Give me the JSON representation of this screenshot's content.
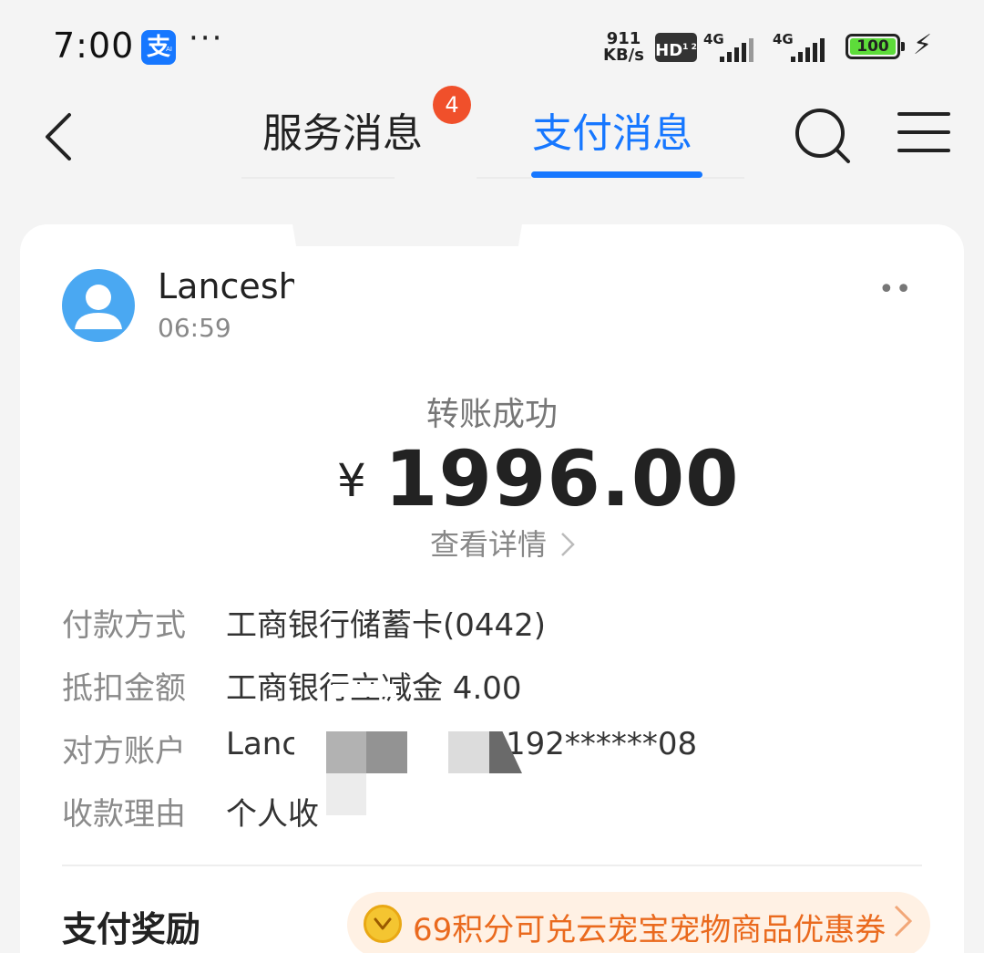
{
  "status_bar": {
    "time": "7:00",
    "app_glyph": "支",
    "app_sub": "AI",
    "more": "···",
    "net_speed_value": "911",
    "net_speed_unit": "KB/s",
    "hd": "HD",
    "hd_sub": "1 2",
    "signal_1": "4G",
    "signal_2": "4G",
    "battery": "100"
  },
  "nav": {
    "tab_service": "服务消息",
    "tab_service_badge": "4",
    "tab_pay": "支付消息",
    "active_color": "#1677ff"
  },
  "message": {
    "sender": "Lancesh",
    "time": "06:59",
    "more": "••",
    "status": "转账成功",
    "currency": "¥",
    "amount": "1996.00",
    "details_link": "查看详情"
  },
  "info_rows": [
    {
      "label": "付款方式",
      "value": "工商银行储蓄卡(0442)"
    },
    {
      "label": "抵扣金额",
      "value": "工商银行立减金 4.00"
    },
    {
      "label": "对方账户",
      "value_prefix": "Lanc",
      "value_suffix": "192******08"
    },
    {
      "label": "收款理由",
      "value": "个人收"
    }
  ],
  "reward": {
    "title": "支付奖励",
    "offer": "69积分可兑云宠宝宠物商品优惠券"
  }
}
